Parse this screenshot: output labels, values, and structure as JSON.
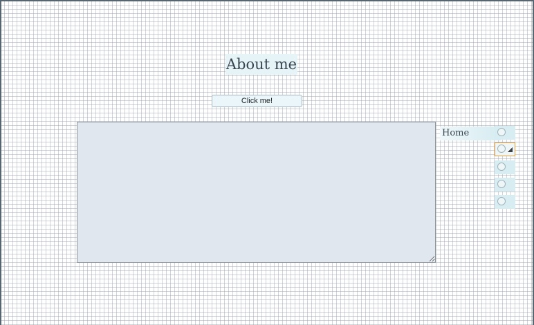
{
  "page": {
    "title": "About me"
  },
  "actions": {
    "click_label": "Click me!"
  },
  "text_area": {
    "value": "",
    "placeholder": ""
  },
  "sidebar": {
    "label": "Home",
    "radios": [
      {
        "selected": false
      },
      {
        "selected": true
      },
      {
        "selected": false
      },
      {
        "selected": false
      },
      {
        "selected": false
      }
    ]
  },
  "colors": {
    "highlight": "#e6f4f8",
    "textarea_bg": "#e1e7ee",
    "focus_border": "#e39a3b"
  }
}
